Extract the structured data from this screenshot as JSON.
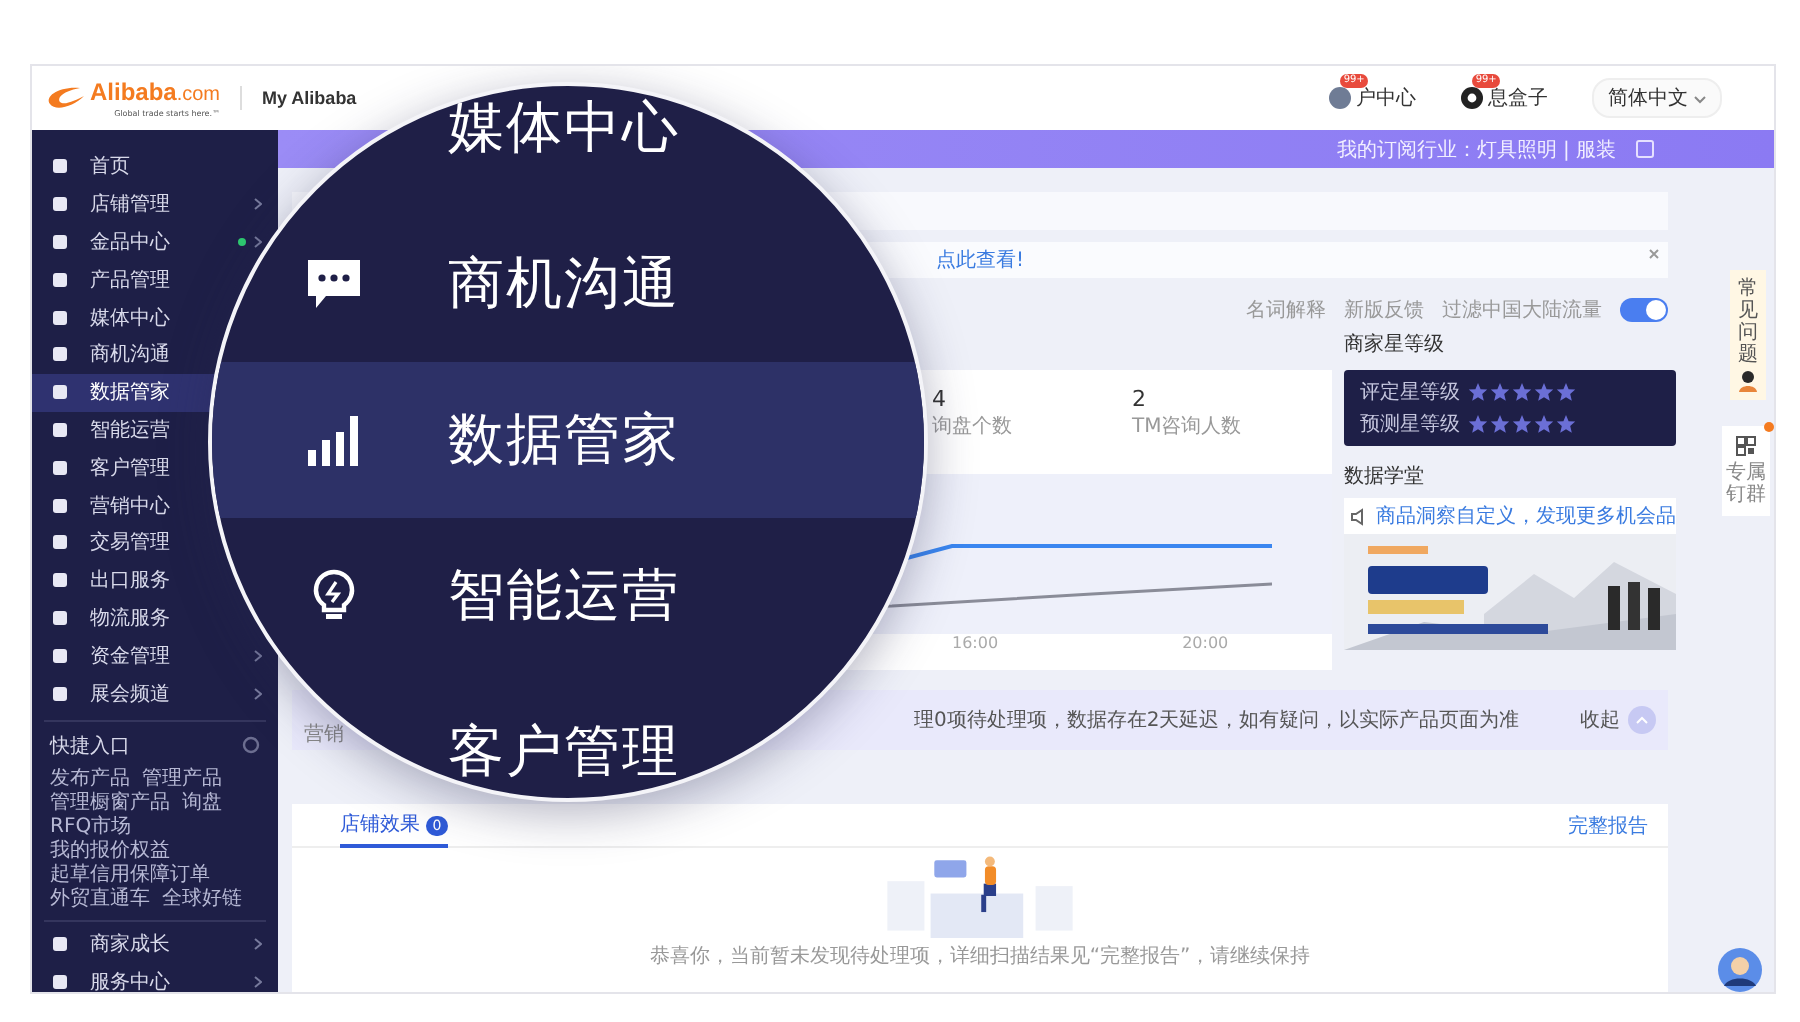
{
  "header": {
    "logo": "Alibaba",
    "logo_suffix": ".com",
    "tagline": "Global trade starts here.™",
    "title": "My Alibaba",
    "links": [
      {
        "label": "户中心",
        "badge": "99+"
      },
      {
        "label": "息盒子",
        "badge": "99+"
      }
    ],
    "language": "简体中文"
  },
  "sidebar": {
    "items": [
      {
        "label": "首页",
        "selected": false,
        "arrow": false,
        "dot": false
      },
      {
        "label": "店铺管理",
        "selected": false,
        "arrow": true,
        "dot": false
      },
      {
        "label": "金品中心",
        "selected": false,
        "arrow": true,
        "dot": true
      },
      {
        "label": "产品管理",
        "selected": false,
        "arrow": false,
        "dot": false
      },
      {
        "label": "媒体中心",
        "selected": false,
        "arrow": false,
        "dot": false
      },
      {
        "label": "商机沟通",
        "selected": false,
        "arrow": false,
        "dot": false
      },
      {
        "label": "数据管家",
        "selected": true,
        "arrow": false,
        "dot": false
      },
      {
        "label": "智能运营",
        "selected": false,
        "arrow": false,
        "dot": false
      },
      {
        "label": "客户管理",
        "selected": false,
        "arrow": false,
        "dot": false
      },
      {
        "label": "营销中心",
        "selected": false,
        "arrow": false,
        "dot": false
      },
      {
        "label": "交易管理",
        "selected": false,
        "arrow": false,
        "dot": false
      },
      {
        "label": "出口服务",
        "selected": false,
        "arrow": false,
        "dot": false
      },
      {
        "label": "物流服务",
        "selected": false,
        "arrow": false,
        "dot": false
      },
      {
        "label": "资金管理",
        "selected": false,
        "arrow": true,
        "dot": false
      },
      {
        "label": "展会频道",
        "selected": false,
        "arrow": true,
        "dot": false
      }
    ],
    "quick": {
      "title": "快捷入口",
      "links": [
        "发布产品",
        "管理产品",
        "管理橱窗产品",
        "询盘",
        "RFQ市场",
        "我的报价权益",
        "起草信用保障订单",
        "外贸直通车",
        "全球好链"
      ]
    },
    "bottom_items": [
      {
        "label": "商家成长",
        "arrow": true
      },
      {
        "label": "服务中心",
        "arrow": true
      }
    ]
  },
  "subscription_bar": {
    "text": "我的订阅行业：灯具照明 | 服装"
  },
  "notice": {
    "link": "点此查看!"
  },
  "links": [
    "名词解释",
    "新版反馈"
  ],
  "filter_toggle": {
    "label": "过滤中国大陆流量",
    "on": true
  },
  "stats": [
    {
      "value": "4",
      "label": "询盘个数"
    },
    {
      "value": "2",
      "label": "TM咨询人数"
    }
  ],
  "chart": {
    "x_labels": [
      "16:00",
      "20:00"
    ]
  },
  "star_rating": {
    "title": "商家星等级",
    "rows": [
      {
        "label": "评定星等级",
        "stars": 5
      },
      {
        "label": "预测星等级",
        "stars": 5
      }
    ]
  },
  "data_school": {
    "title": "数据学堂",
    "tip": "商品洞察自定义，发现更多机会品"
  },
  "summary": {
    "section": "营销",
    "text": "理0项待处理项，数据存在2天延迟，如有疑问，以实际产品页面为准",
    "collapse": "收起"
  },
  "tabs": [
    {
      "label": "店铺效果",
      "badge": "0",
      "selected": true
    }
  ],
  "full_report": "完整报告",
  "empty_text": "恭喜你，当前暂未发现待处理项，详细扫描结果见“完整报告”，请继续保持",
  "float_panel": {
    "faq": "常见问题",
    "group": "专属钉群",
    "group_dot": true
  },
  "magnifier": {
    "items": [
      {
        "label": "媒体中心",
        "selected": false
      },
      {
        "label": "商机沟通",
        "selected": false
      },
      {
        "label": "数据管家",
        "selected": true
      },
      {
        "label": "智能运营",
        "selected": false
      },
      {
        "label": "客户管理",
        "selected": false
      }
    ]
  }
}
